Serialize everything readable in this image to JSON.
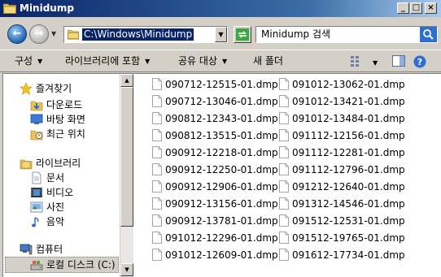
{
  "window": {
    "title": "Minidump"
  },
  "address": {
    "path": "C:\\Windows\\Minidump"
  },
  "search": {
    "placeholder": "Minidump 검색"
  },
  "toolbar": {
    "organize": "구성",
    "include_library": "라이브러리에 포함",
    "share": "공유 대상",
    "new_folder": "새 폴더"
  },
  "nav": {
    "favorites": "즐겨찾기",
    "downloads": "다운로드",
    "desktop": "바탕 화면",
    "recent": "최근 위치",
    "libraries": "라이브러리",
    "documents": "문서",
    "videos": "비디오",
    "pictures": "사진",
    "music": "음악",
    "computer": "컴퓨터",
    "local_disk": "로컬 디스크 (C:)"
  },
  "files": {
    "col1": [
      "090712-12515-01.dmp",
      "090712-13046-01.dmp",
      "090812-12343-01.dmp",
      "090812-13515-01.dmp",
      "090912-12218-01.dmp",
      "090912-12250-01.dmp",
      "090912-12906-01.dmp",
      "090912-13156-01.dmp",
      "090912-13781-01.dmp",
      "091012-12296-01.dmp",
      "091012-12609-01.dmp"
    ],
    "col2": [
      "091012-13062-01.dmp",
      "091012-13421-01.dmp",
      "091012-13484-01.dmp",
      "091112-12156-01.dmp",
      "091112-12281-01.dmp",
      "091112-12796-01.dmp",
      "091212-12640-01.dmp",
      "091312-14546-01.dmp",
      "091512-12531-01.dmp",
      "091512-19765-01.dmp",
      "091612-17734-01.dmp"
    ]
  },
  "icons": {
    "folder": "folder-icon",
    "star": "star-icon",
    "file": "file-icon"
  },
  "colors": {
    "title_bar": "#0a246a",
    "selection": "#0a246a",
    "window_bg": "#d4d0c8"
  }
}
